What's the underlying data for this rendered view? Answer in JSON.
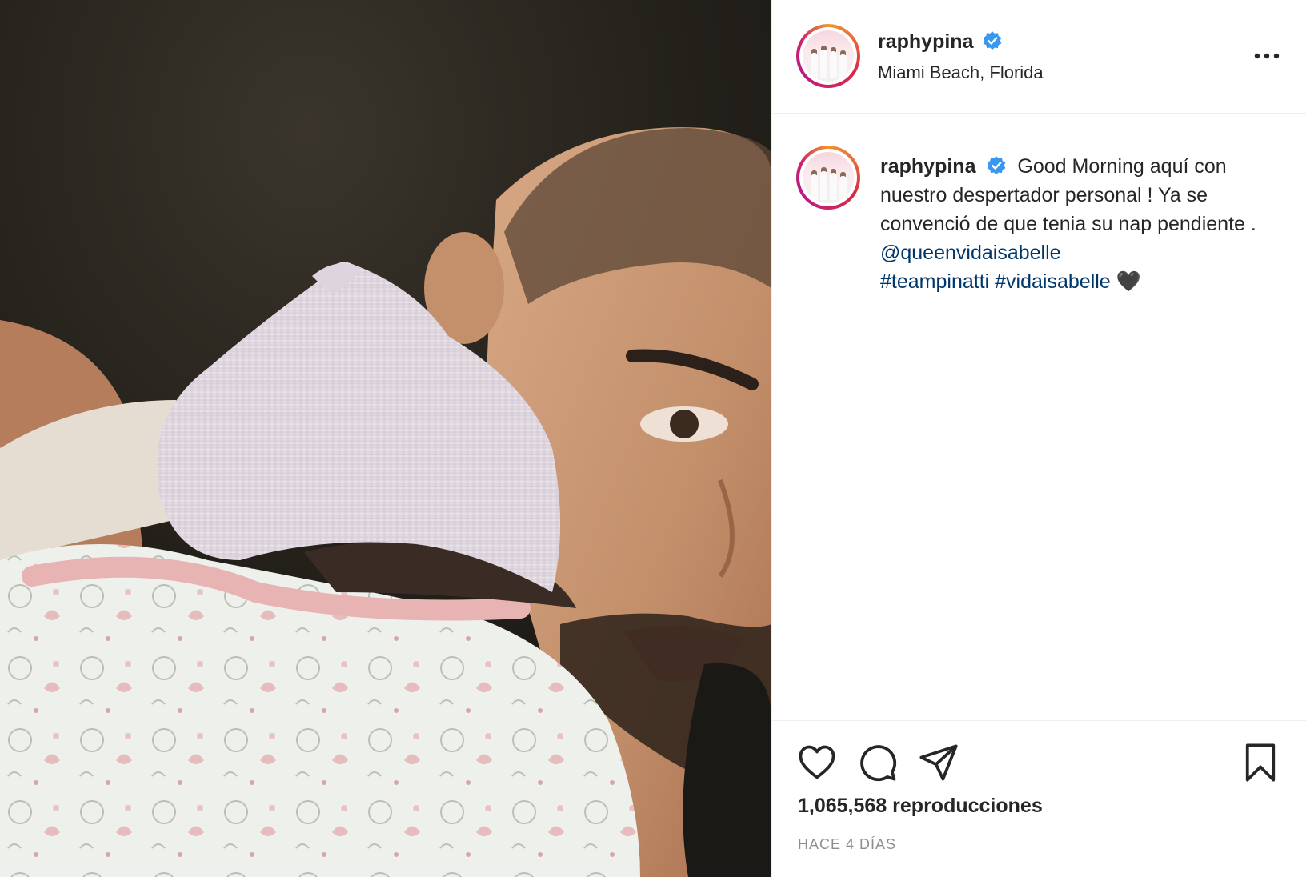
{
  "post": {
    "username": "raphypina",
    "location": "Miami Beach, Florida",
    "verified": true,
    "caption": {
      "username": "raphypina",
      "text": "Good Morning aquí con nuestro despertador personal ! Ya se convenció de que tenia su nap pendiente . ",
      "mention": "@queenvidaisabelle",
      "hashtags": [
        "#teampinatti",
        "#vidaisabelle"
      ],
      "emoji": "🖤"
    },
    "views_count": "1,065,568",
    "views_label": "reproducciones",
    "timestamp": "HACE 4 DÍAS"
  },
  "icons": {
    "like": "heart-icon",
    "comment": "comment-icon",
    "share": "paper-plane-icon",
    "save": "bookmark-icon",
    "more": "more-options-icon",
    "verified": "verified-badge-icon"
  },
  "colors": {
    "link": "#00376b",
    "verified": "#3897f0",
    "text": "#262626",
    "muted": "#8e8e8e"
  }
}
